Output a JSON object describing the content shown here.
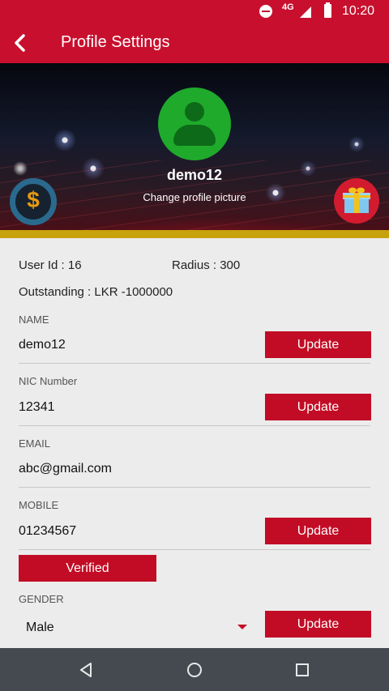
{
  "status_bar": {
    "network": "4G",
    "time": "10:20"
  },
  "app_bar": {
    "title": "Profile Settings"
  },
  "profile": {
    "username": "demo12",
    "change_picture_label": "Change profile picture",
    "currency_symbol": "$"
  },
  "info": {
    "user_id": "User Id : 16",
    "radius": "Radius : 300",
    "outstanding": "Outstanding : LKR -1000000"
  },
  "fields": {
    "name": {
      "label": "NAME",
      "value": "demo12",
      "button": "Update"
    },
    "nic": {
      "label": "NIC Number",
      "value": "12341",
      "button": "Update"
    },
    "email": {
      "label": "EMAIL",
      "value": "abc@gmail.com"
    },
    "mobile": {
      "label": "MOBILE",
      "value": "01234567",
      "button": "Update",
      "verified_label": "Verified"
    },
    "gender": {
      "label": "GENDER",
      "selected": "Male",
      "button": "Update"
    }
  },
  "colors": {
    "primary": "#c8102e",
    "button": "#c20c25",
    "accent_gold": "#c8a20c",
    "avatar_green": "#1faa2c",
    "nav_bar": "#444a50"
  },
  "icons": [
    "back-arrow-icon",
    "do-not-disturb-icon",
    "signal-icon",
    "battery-icon",
    "user-avatar-icon",
    "dollar-icon",
    "gift-icon",
    "dropdown-arrow-icon",
    "nav-back-icon",
    "nav-home-icon",
    "nav-recents-icon"
  ]
}
